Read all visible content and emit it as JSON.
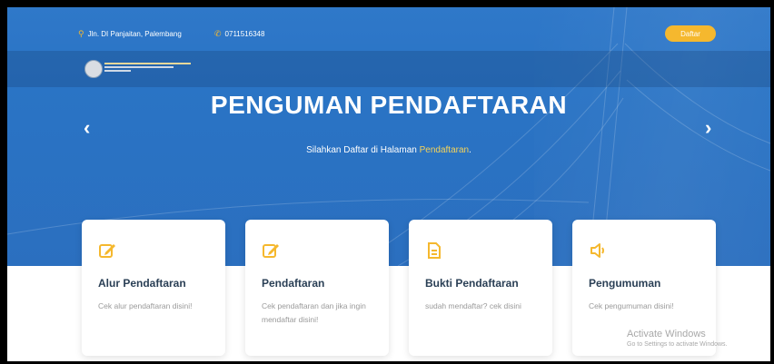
{
  "topbar": {
    "address": "Jln. DI Panjaitan, Palembang",
    "phone": "0711516348",
    "register_button": "Daftar",
    "address_icon": "map-pin-icon",
    "phone_icon": "phone-icon"
  },
  "logo": {
    "name": "school-logo"
  },
  "hero": {
    "title": "PENGUMAN PENDAFTARAN",
    "subtitle_prefix": "Silahkan Daftar di Halaman ",
    "subtitle_link": "Pendaftaran",
    "subtitle_suffix": ".",
    "prev_icon": "chevron-left-icon",
    "next_icon": "chevron-right-icon"
  },
  "cards": [
    {
      "icon": "edit-icon",
      "title": "Alur Pendaftaran",
      "desc": "Cek alur pendaftaran disini!"
    },
    {
      "icon": "edit-icon",
      "title": "Pendaftaran",
      "desc": "Cek pendaftaran dan jika ingin mendaftar disini!"
    },
    {
      "icon": "document-icon",
      "title": "Bukti Pendaftaran",
      "desc": "sudah mendaftar? cek disini"
    },
    {
      "icon": "megaphone-icon",
      "title": "Pengumuman",
      "desc": "Cek pengumuman disini!"
    }
  ],
  "watermark": {
    "line1": "Activate Windows",
    "line2": "Go to Settings to activate Windows."
  },
  "colors": {
    "hero_blue": "#2b74c6",
    "accent_yellow": "#f5b82e",
    "card_title": "#2a3f55",
    "card_text": "#9a9a9a"
  }
}
